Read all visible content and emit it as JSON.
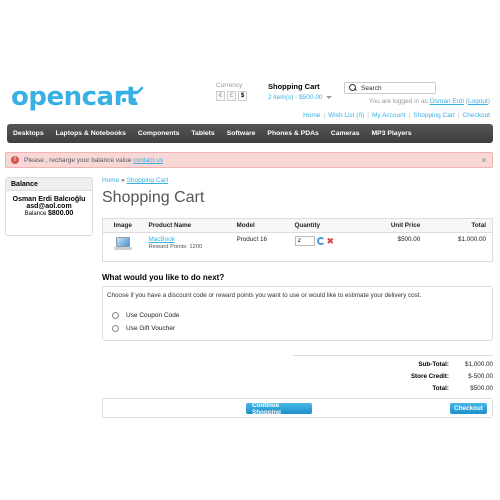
{
  "header": {
    "logo_text": "opencart",
    "currency": {
      "label": "Currency",
      "options": [
        "€",
        "£",
        "$"
      ],
      "selected": "$"
    },
    "cart": {
      "heading": "Shopping Cart",
      "summary": "2 item(s) - $500.00"
    },
    "search": {
      "placeholder": "Search"
    },
    "welcome": {
      "prefix": "You are logged in as ",
      "user": "Osman Erdi",
      "open": " (",
      "logout": "Logout",
      "close": ")"
    },
    "links": [
      "Home",
      "Wish List (0)",
      "My Account",
      "Shopping Cart",
      "Checkout"
    ]
  },
  "menu": [
    "Desktops",
    "Laptops & Notebooks",
    "Components",
    "Tablets",
    "Software",
    "Phones & PDAs",
    "Cameras",
    "MP3 Players"
  ],
  "alert": {
    "text": "Please , recharge your balance value",
    "link": "contact us",
    "close": "×"
  },
  "balance": {
    "heading": "Balance",
    "name": "Osman Erdi Balcıoğlu",
    "email": "asd@aol.com",
    "amount_label": "Balance",
    "amount": "$800.00"
  },
  "breadcrumb": {
    "home": "Home",
    "sep": " » ",
    "current": "Shopping Cart"
  },
  "page_title": "Shopping Cart",
  "table": {
    "headers": {
      "image": "Image",
      "name": "Product Name",
      "model": "Model",
      "quantity": "Quantity",
      "unit_price": "Unit Price",
      "total": "Total"
    },
    "rows": [
      {
        "name": "MacBook",
        "reward": "Reward Points: 1200",
        "model": "Product 16",
        "quantity": "2",
        "unit_price": "$500.00",
        "total": "$1,000.00"
      }
    ]
  },
  "next": {
    "title": "What would you like to do next?",
    "description": "Choose if you have a discount code or reward points you want to use or would like to estimate your delivery cost.",
    "options": [
      "Use Coupon Code",
      "Use Gift Voucher"
    ]
  },
  "totals": [
    {
      "label": "Sub-Total:",
      "value": "$1,000.00"
    },
    {
      "label": "Store Credit:",
      "value": "$-500.00"
    },
    {
      "label": "Total:",
      "value": "$500.00"
    }
  ],
  "buttons": {
    "continue": "Continue Shopping",
    "checkout": "Checkout"
  }
}
